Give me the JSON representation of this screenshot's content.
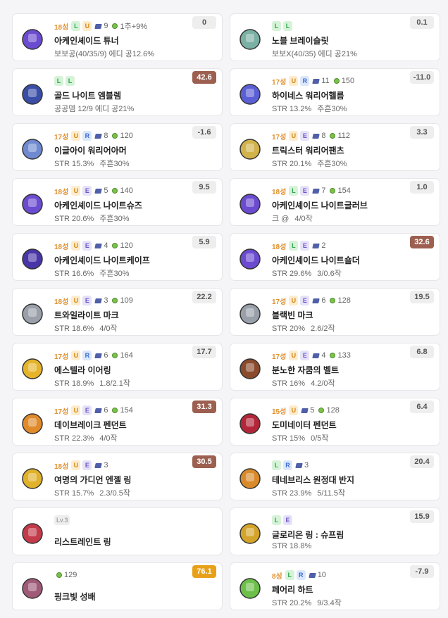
{
  "items": [
    {
      "star": "18성",
      "badges": [
        "L",
        "U"
      ],
      "scrolls": "9",
      "potential": "1추+9%",
      "name": "아케인셰이드 튜너",
      "stats": [
        "보보공(40/35/9) 에디 공12.6%"
      ],
      "score": "0",
      "score_style": "normal",
      "icon": "tuner-weapon-icon",
      "color": "#6b4bd0"
    },
    {
      "star": "",
      "badges": [
        "L",
        "L"
      ],
      "scrolls": "",
      "potential": "",
      "name": "노블 브레이슬릿",
      "stats": [
        "보보X(40/35) 에디 공21%"
      ],
      "score": "0.1",
      "score_style": "normal",
      "icon": "bracelet-icon",
      "color": "#7bb0a4"
    },
    {
      "star": "",
      "badges": [
        "L",
        "L"
      ],
      "scrolls": "",
      "potential": "",
      "name": "골드 나이트 엠블렘",
      "stats": [
        "공공뎀 12/9 에디 공21%"
      ],
      "score": "42.6",
      "score_style": "hi",
      "icon": "emblem-icon",
      "color": "#3a4ea8"
    },
    {
      "star": "17성",
      "badges": [
        "U",
        "R"
      ],
      "scrolls": "11",
      "potential": "150",
      "name": "하이네스 워리어헬름",
      "stats": [
        "STR 13.2%",
        "주흔30%"
      ],
      "score": "-11.0",
      "score_style": "normal",
      "icon": "helmet-icon",
      "color": "#5b5fd6"
    },
    {
      "star": "17성",
      "badges": [
        "U",
        "R"
      ],
      "scrolls": "8",
      "potential": "120",
      "name": "이글아이 워리어아머",
      "stats": [
        "STR 15.3%",
        "주흔30%"
      ],
      "score": "-1.6",
      "score_style": "normal",
      "icon": "armor-icon",
      "color": "#6f8ad0"
    },
    {
      "star": "17성",
      "badges": [
        "U",
        "E"
      ],
      "scrolls": "8",
      "potential": "112",
      "name": "트릭스터 워리어팬츠",
      "stats": [
        "STR 20.1%",
        "주흔30%"
      ],
      "score": "3.3",
      "score_style": "normal",
      "icon": "pants-icon",
      "color": "#d2b24a"
    },
    {
      "star": "18성",
      "badges": [
        "U",
        "E"
      ],
      "scrolls": "5",
      "potential": "140",
      "name": "아케인셰이드 나이트슈즈",
      "stats": [
        "STR 20.6%",
        "주흔30%"
      ],
      "score": "9.5",
      "score_style": "normal",
      "icon": "shoes-icon",
      "color": "#6b4bd0"
    },
    {
      "star": "18성",
      "badges": [
        "L",
        "E"
      ],
      "scrolls": "7",
      "potential": "154",
      "name": "아케인셰이드 나이트글러브",
      "stats": [
        "크 @",
        "4/0작"
      ],
      "score": "1.0",
      "score_style": "normal",
      "icon": "glove-icon",
      "color": "#6b4bd0"
    },
    {
      "star": "18성",
      "badges": [
        "U",
        "E"
      ],
      "scrolls": "4",
      "potential": "120",
      "name": "아케인셰이드 나이트케이프",
      "stats": [
        "STR 16.6%",
        "주흔30%"
      ],
      "score": "5.9",
      "score_style": "normal",
      "icon": "cape-icon",
      "color": "#4a35a8"
    },
    {
      "star": "18성",
      "badges": [
        "L",
        "E"
      ],
      "scrolls": "2",
      "potential": "",
      "name": "아케인셰이드 나이트숄더",
      "stats": [
        "STR 29.6%",
        "3/0.6작"
      ],
      "score": "32.6",
      "score_style": "hi",
      "icon": "shoulder-icon",
      "color": "#6b4bd0"
    },
    {
      "star": "18성",
      "badges": [
        "U",
        "E"
      ],
      "scrolls": "3",
      "potential": "109",
      "name": "트와일라이트 마크",
      "stats": [
        "STR 18.6%",
        "4/0작"
      ],
      "score": "22.2",
      "score_style": "normal",
      "icon": "face-accessory-icon",
      "color": "#9aa0aa"
    },
    {
      "star": "17성",
      "badges": [
        "U",
        "E"
      ],
      "scrolls": "6",
      "potential": "128",
      "name": "블랙빈 마크",
      "stats": [
        "STR 20%",
        "2.6/2작"
      ],
      "score": "19.5",
      "score_style": "normal",
      "icon": "eye-accessory-icon",
      "color": "#9aa0aa"
    },
    {
      "star": "17성",
      "badges": [
        "U",
        "R"
      ],
      "scrolls": "6",
      "potential": "164",
      "name": "에스텔라 이어링",
      "stats": [
        "STR 18.9%",
        "1.8/2.1작"
      ],
      "score": "17.7",
      "score_style": "normal",
      "icon": "earring-icon",
      "color": "#e6b42a"
    },
    {
      "star": "17성",
      "badges": [
        "U",
        "E"
      ],
      "scrolls": "4",
      "potential": "133",
      "name": "분노한 자쿰의 벨트",
      "stats": [
        "STR 16%",
        "4.2/0작"
      ],
      "score": "6.8",
      "score_style": "normal",
      "icon": "belt-icon",
      "color": "#8a4b2c"
    },
    {
      "star": "17성",
      "badges": [
        "U",
        "E"
      ],
      "scrolls": "6",
      "potential": "154",
      "name": "데이브레이크 펜던트",
      "stats": [
        "STR 22.3%",
        "4/0작"
      ],
      "score": "31.3",
      "score_style": "hi",
      "icon": "pendant-icon",
      "color": "#e08a2a"
    },
    {
      "star": "15성",
      "badges": [
        "U"
      ],
      "scrolls": "5",
      "potential": "128",
      "name": "도미네이터 펜던트",
      "stats": [
        "STR 15%",
        "0/5작"
      ],
      "score": "6.4",
      "score_style": "normal",
      "icon": "dominator-pendant-icon",
      "color": "#b3263a"
    },
    {
      "star": "18성",
      "badges": [
        "U",
        "E"
      ],
      "scrolls": "3",
      "potential": "",
      "name": "여명의 가디언 엔젤 링",
      "stats": [
        "STR 15.7%",
        "2.3/0.5작"
      ],
      "score": "30.5",
      "score_style": "hi",
      "icon": "ring-icon",
      "color": "#e0b12a"
    },
    {
      "star": "",
      "badges": [
        "L",
        "R"
      ],
      "scrolls": "3",
      "potential": "",
      "name": "테네브리스 원정대 반지",
      "stats": [
        "STR 23.9%",
        "5/11.5작"
      ],
      "score": "20.4",
      "score_style": "normal",
      "icon": "ring-icon",
      "color": "#d98a2a"
    },
    {
      "star": "",
      "level": "Lv.3",
      "badges": [],
      "scrolls": "",
      "potential": "",
      "name": "리스트레인트 링",
      "stats": [],
      "score": "",
      "score_style": "none",
      "icon": "restraint-ring-icon",
      "color": "#c43a4a"
    },
    {
      "star": "",
      "badges": [
        "L",
        "E"
      ],
      "scrolls": "",
      "potential": "",
      "name": "글로리온 링 : 슈프림",
      "stats": [
        "STR 18.8%"
      ],
      "score": "15.9",
      "score_style": "normal",
      "icon": "glorion-ring-icon",
      "color": "#d4a42a"
    },
    {
      "star": "",
      "badges": [],
      "scrolls": "",
      "potential": "129",
      "name": "핑크빛 성배",
      "stats": [],
      "score": "76.1",
      "score_style": "gold",
      "icon": "chalice-icon",
      "color": "#a05a78"
    },
    {
      "star": "8성",
      "badges": [
        "L",
        "R"
      ],
      "scrolls": "10",
      "potential": "",
      "name": "페어리 하트",
      "stats": [
        "STR 20.2%",
        "9/3.4작"
      ],
      "score": "-7.9",
      "score_style": "normal",
      "icon": "heart-icon",
      "color": "#6cc04a"
    }
  ]
}
